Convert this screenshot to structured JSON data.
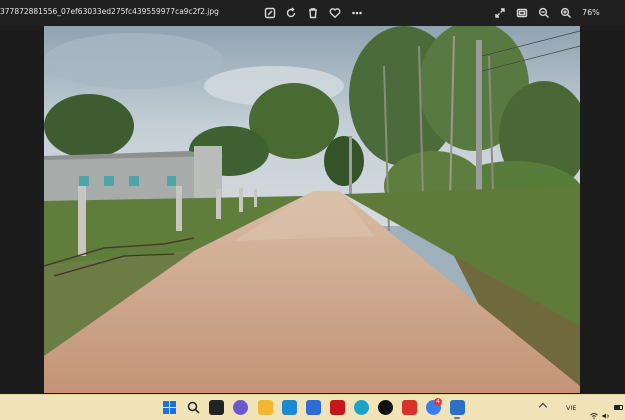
{
  "viewer": {
    "filename": "377872881556_07ef63033ed275fc439559977ca9c2f2.jpg",
    "zoom": "76%",
    "toolbar_icons": [
      "edit-icon",
      "rotate-icon",
      "delete-icon",
      "favorite-icon",
      "more-icon",
      "fullscreen-icon",
      "fit-icon",
      "zoom-out-icon",
      "zoom-in-icon"
    ]
  },
  "photo": {
    "subject": "rural dirt road",
    "colors": {
      "sky": "#b9c6cf",
      "road": "#c9a184",
      "grass": "#5d7a3a",
      "trees": "#3f5e2e",
      "building": "#a9adac"
    }
  },
  "taskbar": {
    "accent": "#f1e3b8",
    "apps": [
      "start-icon",
      "search-icon",
      "task-view-icon",
      "chat-icon",
      "file-explorer-icon",
      "word-icon",
      "store-icon",
      "mcafee-icon",
      "edge-icon",
      "tiktok-icon",
      "wps-icon",
      "messenger-icon",
      "photos-icon"
    ],
    "notification_count": "4",
    "language": "VIE"
  }
}
